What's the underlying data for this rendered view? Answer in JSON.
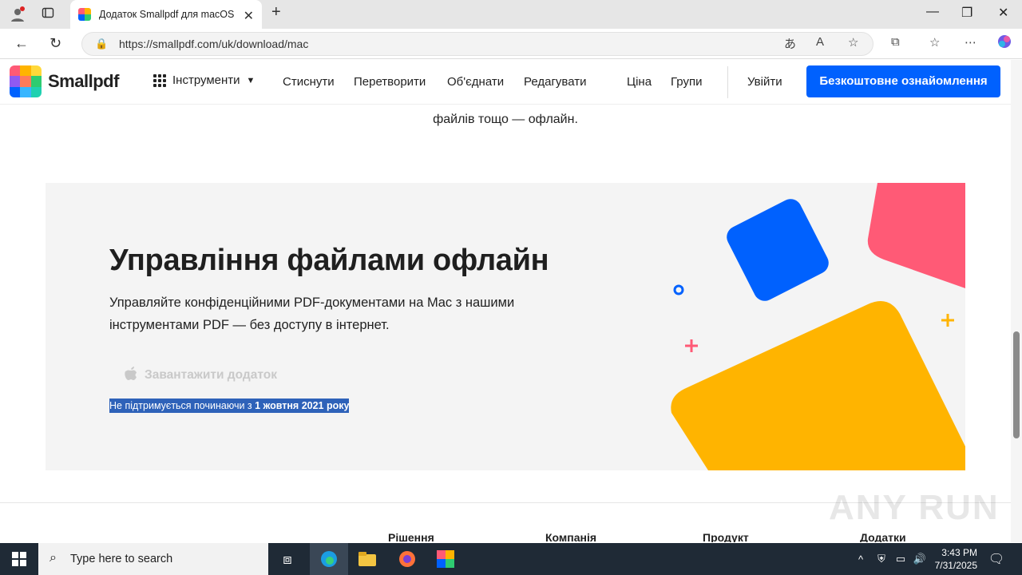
{
  "browser": {
    "tab_title": "Додаток Smallpdf для macOS",
    "url": "https://smallpdf.com/uk/download/mac"
  },
  "site": {
    "logo_text": "Smallpdf",
    "tools_label": "Інструменти",
    "nav": [
      "Стиснути",
      "Перетворити",
      "Об'єднати",
      "Редагувати",
      "Ціна",
      "Групи"
    ],
    "login": "Увійти",
    "cta": "Безкоштовне ознайомлення"
  },
  "intro_text": "файлів тощо — офлайн.",
  "hero": {
    "title": "Управління файлами офлайн",
    "description": "Управляйте конфіденційними PDF-документами на Mac з нашими інструментами PDF — без доступу в інтернет.",
    "download_label": "Завантажити додаток",
    "note_prefix": "Не підтримується починаючи з ",
    "note_date": "1 жовтня 2021 року"
  },
  "footer": {
    "columns": [
      "Рішення",
      "Компанія",
      "Продукт",
      "Додатки"
    ]
  },
  "watermark": "ANY RUN",
  "taskbar": {
    "search_placeholder": "Type here to search",
    "time": "3:43 PM",
    "date": "7/31/2025"
  },
  "colors": {
    "brand_blue": "#0061fe",
    "yellow": "#ffb400",
    "coral": "#ff5a76",
    "selection": "#2e62b9"
  }
}
